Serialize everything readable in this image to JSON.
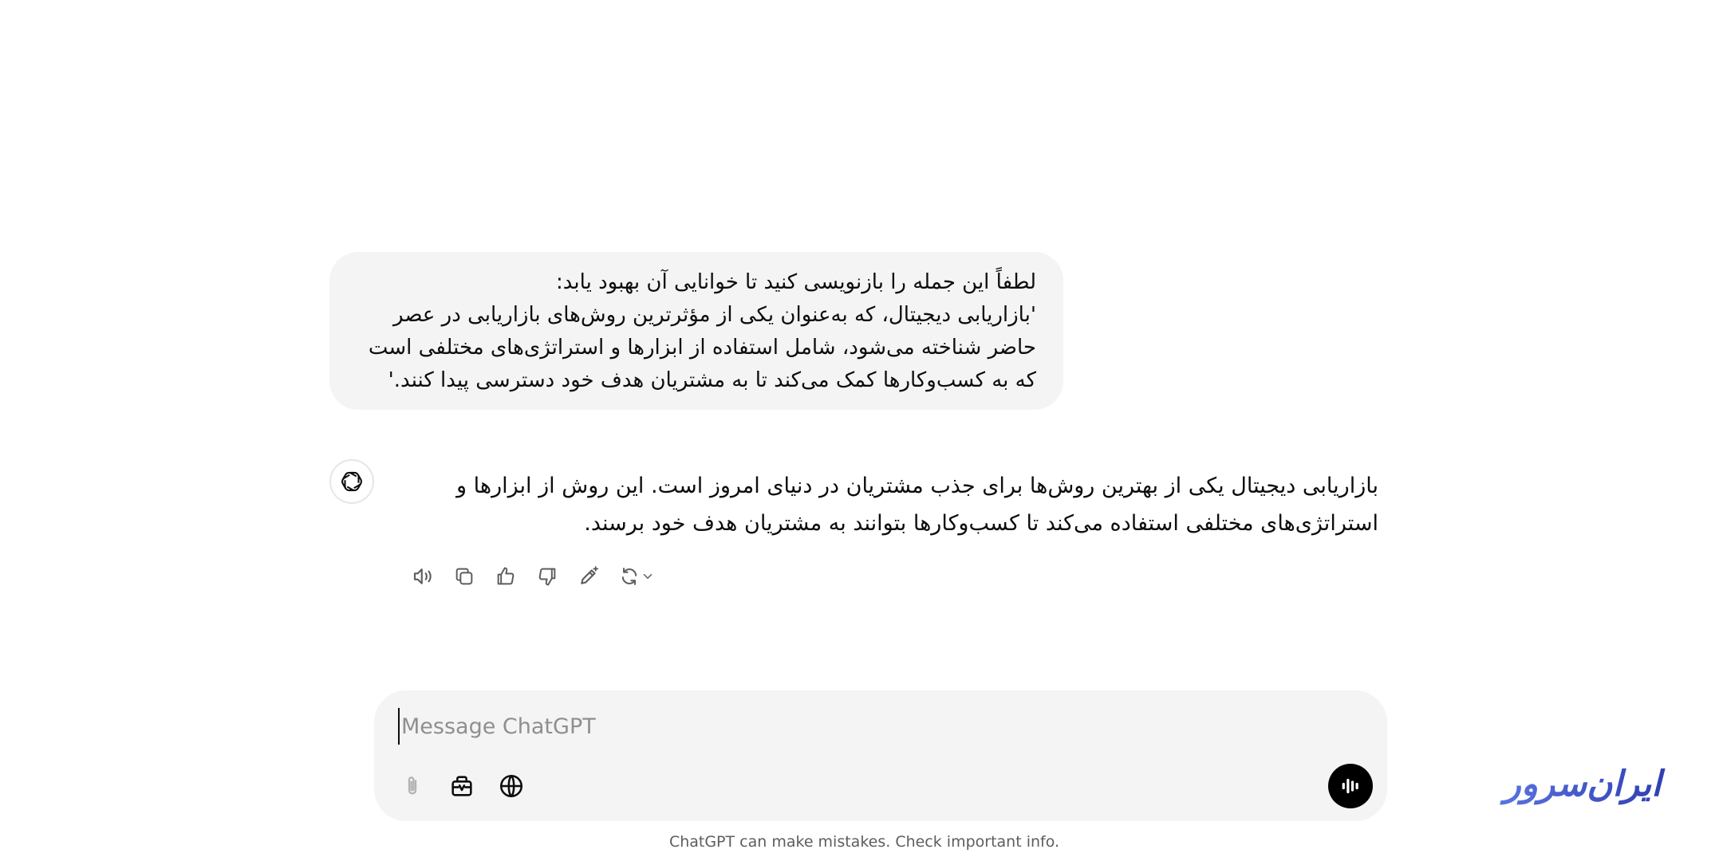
{
  "conversation": {
    "user_message": {
      "lines": [
        "لطفاً این جمله را بازنویسی کنید تا خوانایی آن بهبود یابد:",
        "'بازاریابی دیجیتال، که به‌عنوان یکی از مؤثرترین روش‌های بازاریابی در عصر",
        "حاضر شناخته می‌شود، شامل استفاده از ابزارها و استراتژی‌های مختلفی است",
        "که به کسب‌وکارها کمک می‌کند تا به مشتریان هدف خود دسترسی پیدا کنند.'"
      ]
    },
    "assistant_message": {
      "lines": [
        "بازاریابی دیجیتال یکی از بهترین روش‌ها برای جذب مشتریان در دنیای امروز است. این روش از ابزارها و",
        "استراتژی‌های مختلفی استفاده می‌کند تا کسب‌وکارها بتوانند به مشتریان هدف خود برسند."
      ],
      "avatar_icon": "openai-logo-icon",
      "actions": [
        {
          "name": "read-aloud-button",
          "icon": "speaker-icon"
        },
        {
          "name": "copy-button",
          "icon": "copy-icon"
        },
        {
          "name": "good-response-button",
          "icon": "thumbs-up-icon"
        },
        {
          "name": "bad-response-button",
          "icon": "thumbs-down-icon"
        },
        {
          "name": "edit-in-canvas-button",
          "icon": "pencil-sparkle-icon"
        },
        {
          "name": "regenerate-button",
          "icon": "refresh-icon"
        }
      ]
    }
  },
  "composer": {
    "placeholder": "Message ChatGPT",
    "value": "",
    "tools": [
      {
        "name": "attach-button",
        "icon": "paperclip-icon",
        "enabled": false
      },
      {
        "name": "tools-button",
        "icon": "toolbox-icon",
        "enabled": true
      },
      {
        "name": "search-web-button",
        "icon": "globe-icon",
        "enabled": true
      }
    ],
    "voice_icon": "voice-waveform-icon"
  },
  "footer": {
    "disclaimer": "ChatGPT can make mistakes. Check important info."
  },
  "watermark": {
    "text": "ایران‌سرور",
    "color": "#3b4fc4"
  },
  "colors": {
    "bubble": "#f4f4f4",
    "text": "#0d0d0d",
    "muted": "#5d5d5d"
  }
}
